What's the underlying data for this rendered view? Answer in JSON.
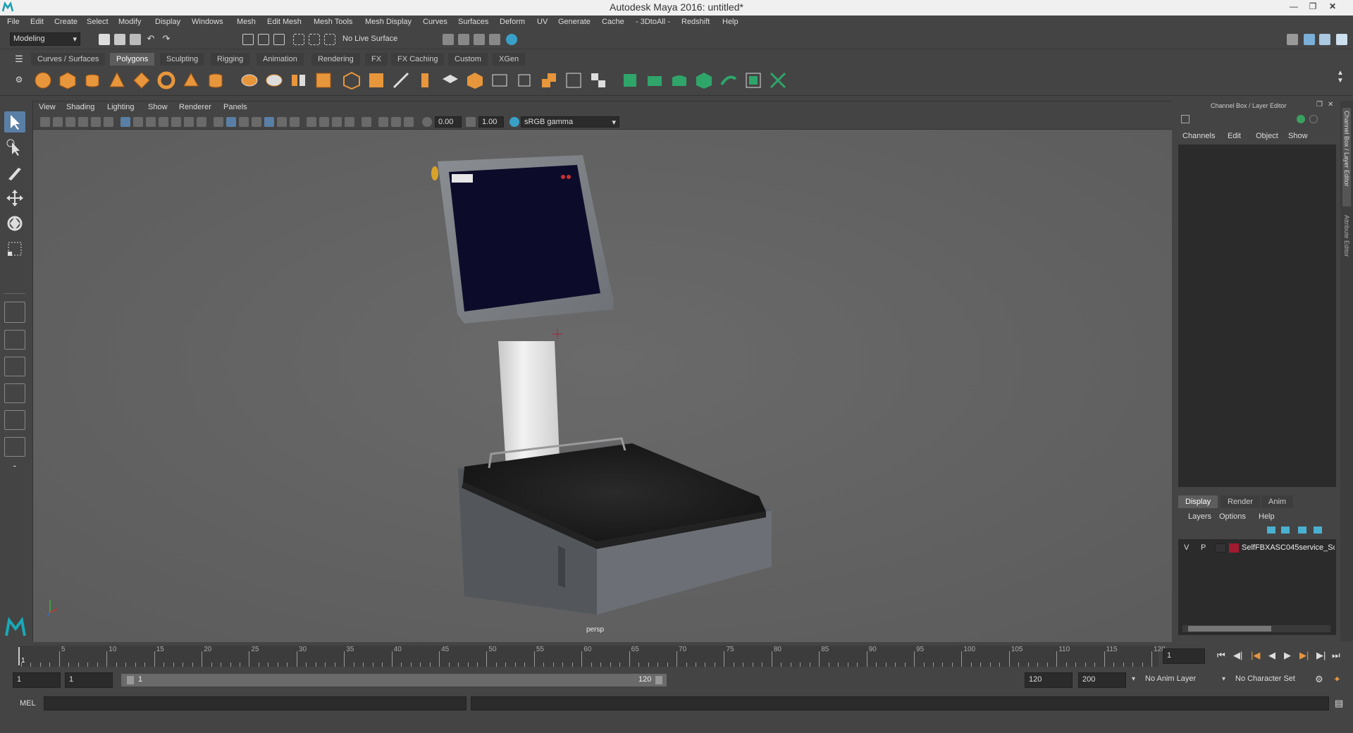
{
  "window": {
    "title": "Autodesk Maya 2016: untitled*",
    "controls": [
      "minimize-icon",
      "restore-icon",
      "close-icon"
    ]
  },
  "menubar": [
    "File",
    "Edit",
    "Create",
    "Select",
    "Modify",
    "Display",
    "Windows",
    "Mesh",
    "Edit Mesh",
    "Mesh Tools",
    "Mesh Display",
    "Curves",
    "Surfaces",
    "Deform",
    "UV",
    "Generate",
    "Cache",
    "- 3DtoAll -",
    "Redshift",
    "Help"
  ],
  "statusline": {
    "mode": "Modeling",
    "live_surface": "No Live Surface"
  },
  "shelf": {
    "tabs": [
      "Curves / Surfaces",
      "Polygons",
      "Sculpting",
      "Rigging",
      "Animation",
      "Rendering",
      "FX",
      "FX Caching",
      "Custom",
      "XGen"
    ],
    "active_tab": "Polygons"
  },
  "viewport": {
    "menu": [
      "View",
      "Shading",
      "Lighting",
      "Show",
      "Renderer",
      "Panels"
    ],
    "exposure": "0.00",
    "gamma": "1.00",
    "color_space": "sRGB gamma",
    "camera_label": "persp"
  },
  "channel_box": {
    "title": "Channel Box / Layer Editor",
    "menu": [
      "Channels",
      "Edit",
      "Object",
      "Show"
    ]
  },
  "layer_editor": {
    "tabs": [
      "Display",
      "Render",
      "Anim"
    ],
    "active_tab": "Display",
    "menu": [
      "Layers",
      "Options",
      "Help"
    ],
    "layers": [
      {
        "v": "V",
        "p": "P",
        "color": "#a01a30",
        "name": "SelfFBXASC045service_Sc"
      }
    ]
  },
  "side_tabs": [
    "Channel Box / Layer Editor",
    "Attribute Editor"
  ],
  "timeline": {
    "ticks": [
      1,
      5,
      10,
      15,
      20,
      25,
      30,
      35,
      40,
      45,
      50,
      55,
      60,
      65,
      70,
      75,
      80,
      85,
      90,
      95,
      100,
      105,
      110,
      115,
      120
    ],
    "current_frame": "1",
    "current_frame_field": "1"
  },
  "range": {
    "start": "1",
    "anim_start": "1",
    "slider_start": "1",
    "slider_end": "120",
    "end": "120",
    "anim_end": "200",
    "anim_layer": "No Anim Layer",
    "character_set": "No Character Set"
  },
  "command_line": {
    "label": "MEL"
  }
}
